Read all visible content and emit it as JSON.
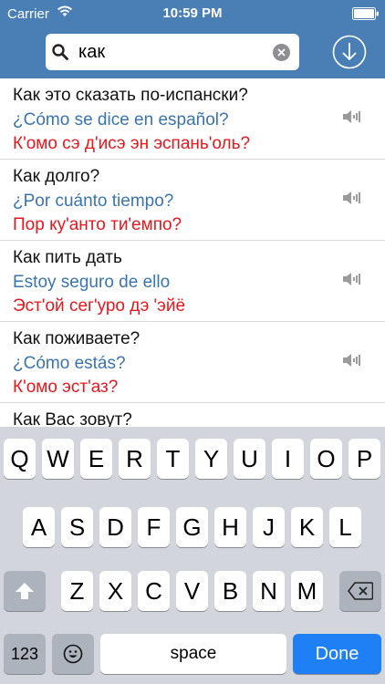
{
  "status_bar": {
    "carrier": "Carrier",
    "time": "10:59 PM"
  },
  "search": {
    "value": "как"
  },
  "colors": {
    "header": "#4a7fb5",
    "spanish": "#3a74ad",
    "transcription": "#e8161d",
    "done": "#1f7ff4"
  },
  "phrases": [
    {
      "ru": "Как это сказать по-испански?",
      "es": "¿Cómo se dice en español?",
      "tr": "К'омо сэ д'исэ эн эспань'оль?"
    },
    {
      "ru": "Как долго?",
      "es": "¿Por cuánto tiempo?",
      "tr": "Пор ку'анто ти'емпо?"
    },
    {
      "ru": "Как пить дать",
      "es": "Estoy seguro de ello",
      "tr": "Эст'ой сег'уро дэ 'эйё"
    },
    {
      "ru": "Как поживаете?",
      "es": "¿Cómo estás?",
      "tr": "К'омо эст'аз?"
    },
    {
      "ru": "Как Вас зовут?"
    }
  ],
  "keyboard": {
    "row1": [
      "Q",
      "W",
      "E",
      "R",
      "T",
      "Y",
      "U",
      "I",
      "O",
      "P"
    ],
    "row2": [
      "A",
      "S",
      "D",
      "F",
      "G",
      "H",
      "J",
      "K",
      "L"
    ],
    "row3": [
      "Z",
      "X",
      "C",
      "V",
      "B",
      "N",
      "M"
    ],
    "numbers_label": "123",
    "space_label": "space",
    "done_label": "Done"
  },
  "icons": [
    "wifi-icon",
    "battery-icon",
    "search-icon",
    "clear-icon",
    "download-icon",
    "speaker-icon",
    "shift-icon",
    "delete-icon",
    "emoji-icon"
  ]
}
